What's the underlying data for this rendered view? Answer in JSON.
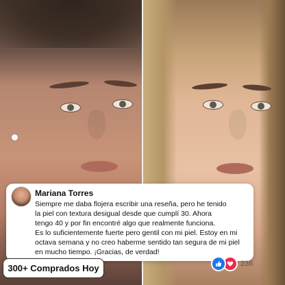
{
  "review": {
    "reviewer_name": "Mariana Torres",
    "lines": [
      "Siempre me daba flojera escribir una reseña, pero he tenido",
      "la piel con textura desigual desde que cumplí 30. Ahora",
      "tengo 40 y por fin encontré algo que realmente funciona.",
      "Es lo suficientemente fuerte pero gentil con mi piel. Estoy en mi",
      "octava semana y no creo haberme sentido tan segura de mi piel",
      "en mucho tiempo. ¡Gracias, de verdad!"
    ]
  },
  "badge": {
    "label": "300+ Comprados Hoy"
  },
  "reactions": {
    "icons": [
      "like-icon",
      "love-icon"
    ],
    "count": "236",
    "colors": {
      "like": "#1877f2",
      "love": "#f0284a"
    }
  }
}
